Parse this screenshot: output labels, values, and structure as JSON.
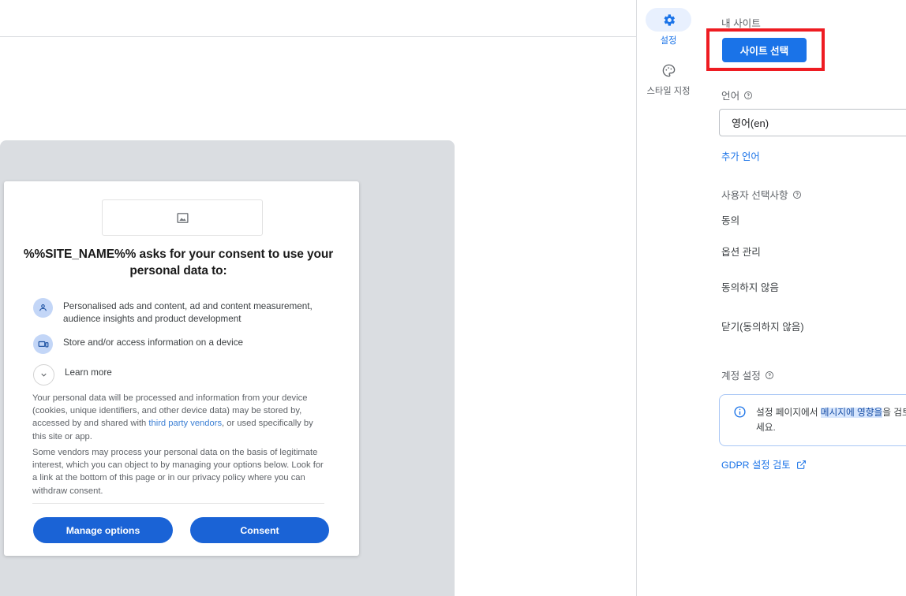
{
  "consent_dialog": {
    "logo_placeholder_icon": "image-placeholder-icon",
    "title": "%%SITE_NAME%% asks for your consent to use your personal data to:",
    "purposes": [
      {
        "icon": "person-icon",
        "text": "Personalised ads and content, ad and content measurement, audience insights and product development"
      },
      {
        "icon": "device-icon",
        "text": "Store and/or access information on a device"
      },
      {
        "icon": "chevron-down-icon",
        "text": "Learn more"
      }
    ],
    "body_paragraph_1_part1": "Your personal data will be processed and information from your device (cookies, unique identifiers, and other device data) may be stored by, accessed by and shared with ",
    "body_paragraph_1_link": "third party vendors",
    "body_paragraph_1_part2": ", or used specifically by this site or app.",
    "body_paragraph_2": "Some vendors may process your personal data on the basis of legitimate interest, which you can object to by managing your options below. Look for a link at the bottom of this page or in our privacy policy where you can withdraw consent.",
    "manage_options_label": "Manage options",
    "consent_label": "Consent"
  },
  "rail": {
    "items": [
      {
        "icon": "gear-icon",
        "label": "설정",
        "active": true
      },
      {
        "icon": "palette-icon",
        "label": "스타일 지정",
        "active": false
      }
    ]
  },
  "panel": {
    "my_site_label": "내 사이트",
    "select_site_button": "사이트 선택",
    "language_label": "언어",
    "language_value": "영어(en)",
    "add_language_link": "추가 언어",
    "user_choices_label": "사용자 선택사항",
    "user_choices": [
      "동의",
      "옵션 관리",
      "동의하지 않음",
      "닫기(동의하지 않음)"
    ],
    "account_settings_label": "계정 설정",
    "info_text_part1": "설정 페이지에서 ",
    "info_text_highlight": "메시지에 영향을",
    "info_text_part2": "을 검토하세요.",
    "info_icon": "info-icon",
    "gdpr_link": "GDPR 설정 검토",
    "gdpr_link_icon": "external-link-icon",
    "help_icon": "help-circle-icon"
  },
  "colors": {
    "accent_blue": "#1a73e8",
    "cmp_blue": "#1a63d6",
    "highlight_red": "#ee1c22",
    "preview_gray": "#dadde1",
    "active_pill": "#e8f0fe"
  }
}
